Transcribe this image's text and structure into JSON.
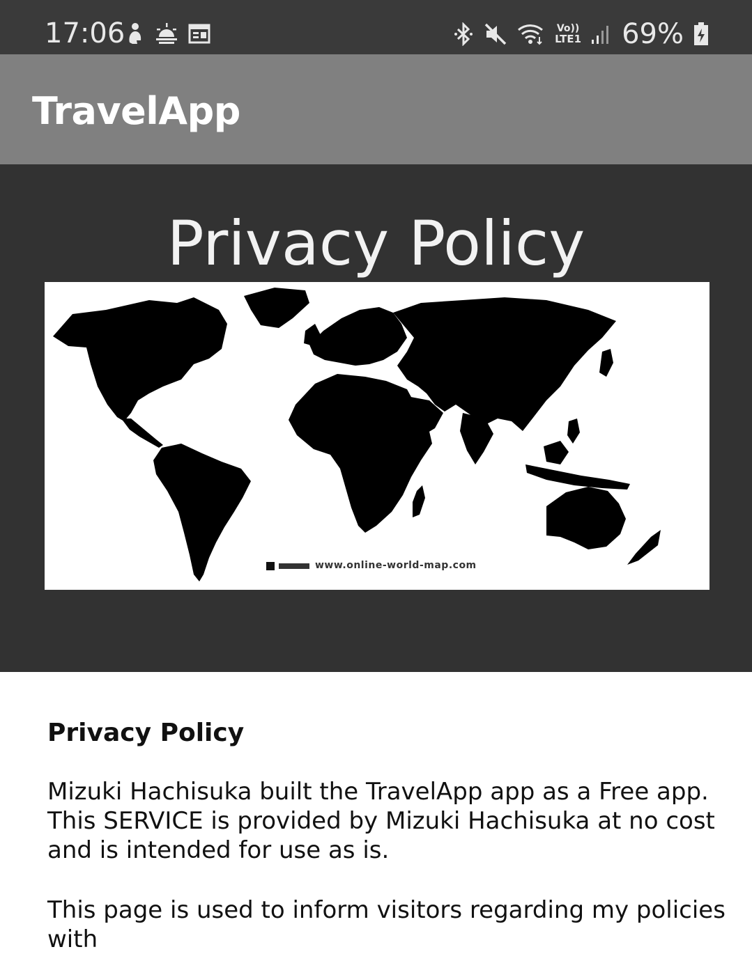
{
  "status_bar": {
    "time": "17:06",
    "left_icons": [
      "notification-icon",
      "weather-icon",
      "calendar-icon"
    ],
    "right_icons": [
      "bluetooth-icon",
      "mute-icon",
      "wifi-icon",
      "volte-icon",
      "signal-icon",
      "battery-icon"
    ],
    "battery_percent": "69%",
    "volte_label_top": "Vo))",
    "volte_label_bottom": "LTE1"
  },
  "app_bar": {
    "title": "TravelApp"
  },
  "hero": {
    "title": "Privacy Policy",
    "map_caption": "www.online-world-map.com"
  },
  "content": {
    "heading": "Privacy Policy",
    "paragraphs": [
      "Mizuki Hachisuka built the TravelApp app as a Free app. This SERVICE is provided by Mizuki Hachisuka at no cost and is intended for use as is.",
      "This page is used to inform visitors regarding my policies with"
    ]
  },
  "colors": {
    "status_bar_bg": "#3a3a3a",
    "app_bar_bg": "#808080",
    "hero_bg": "#323232",
    "content_bg": "#ffffff"
  }
}
